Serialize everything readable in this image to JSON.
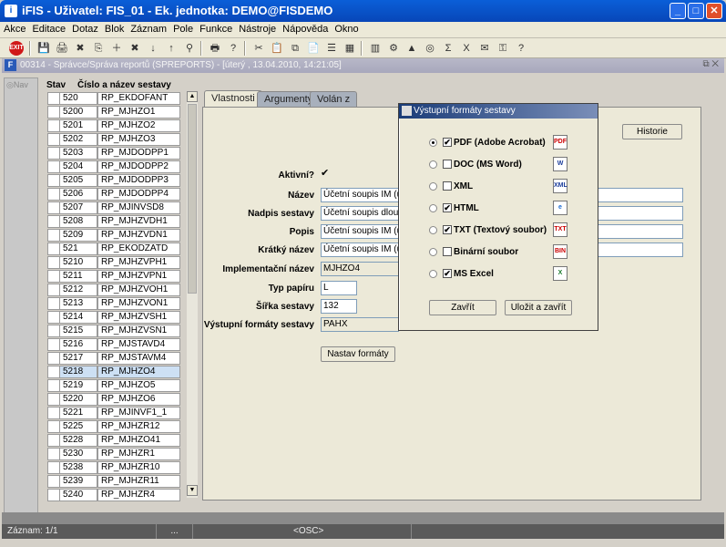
{
  "window": {
    "title": "iFIS - Uživatel: FIS_01 - Ek. jednotka: DEMO@FISDEMO",
    "minimize": "_",
    "maximize": "□",
    "close": "✕"
  },
  "menu": [
    "Akce",
    "Editace",
    "Dotaz",
    "Blok",
    "Záznam",
    "Pole",
    "Funkce",
    "Nástroje",
    "Nápověda",
    "Okno"
  ],
  "toolbar": {
    "exit_label": "EXIT",
    "icons": [
      "save-icon",
      "print-icon",
      "delete-icon",
      "copy-icon",
      "insert-icon",
      "delete-record-icon",
      "sort-asc-icon",
      "sort-desc-icon",
      "filter-icon",
      "printer-icon",
      "query-icon",
      "cut-icon",
      "paste-icon",
      "copy-doc-icon",
      "clipboard-icon",
      "list-icon",
      "grid-icon",
      "calc-icon",
      "settings-icon",
      "chart-icon",
      "globe-icon",
      "sum-icon",
      "excel-icon",
      "mail-icon",
      "key-icon",
      "help-icon"
    ],
    "glyphs": [
      "💾",
      "🖨",
      "✖",
      "⎘",
      "＋",
      "✖",
      "↓",
      "↑",
      "⚲",
      "🖶",
      "?",
      "✂",
      "📋",
      "⧉",
      "📄",
      "☰",
      "▦",
      "▥",
      "⚙",
      "▲",
      "◎",
      "Σ",
      "X",
      "✉",
      "⚿",
      "?"
    ]
  },
  "inner_window": {
    "title": "00314 - Správce/Správa reportů (SPREPORTS) - [úterý , 13.04.2010, 14:21:05]",
    "restore": "⧉ ✕"
  },
  "nav": {
    "label": "Nav"
  },
  "list": {
    "header_stav": "Stav",
    "header_cislo": "Číslo a název sestavy",
    "rows": [
      {
        "num": "520",
        "name": "RP_EKDOFANT"
      },
      {
        "num": "5200",
        "name": "RP_MJHZO1"
      },
      {
        "num": "5201",
        "name": "RP_MJHZO2"
      },
      {
        "num": "5202",
        "name": "RP_MJHZO3"
      },
      {
        "num": "5203",
        "name": "RP_MJDODPP1"
      },
      {
        "num": "5204",
        "name": "RP_MJDODPP2"
      },
      {
        "num": "5205",
        "name": "RP_MJDODPP3"
      },
      {
        "num": "5206",
        "name": "RP_MJDODPP4"
      },
      {
        "num": "5207",
        "name": "RP_MJINVSD8"
      },
      {
        "num": "5208",
        "name": "RP_MJHZVDH1"
      },
      {
        "num": "5209",
        "name": "RP_MJHZVDN1"
      },
      {
        "num": "521",
        "name": "RP_EKODZATD"
      },
      {
        "num": "5210",
        "name": "RP_MJHZVPH1"
      },
      {
        "num": "5211",
        "name": "RP_MJHZVPN1"
      },
      {
        "num": "5212",
        "name": "RP_MJHZVOH1"
      },
      {
        "num": "5213",
        "name": "RP_MJHZVON1"
      },
      {
        "num": "5214",
        "name": "RP_MJHZVSH1"
      },
      {
        "num": "5215",
        "name": "RP_MJHZVSN1"
      },
      {
        "num": "5216",
        "name": "RP_MJSTAVD4"
      },
      {
        "num": "5217",
        "name": "RP_MJSTAVM4"
      },
      {
        "num": "5218",
        "name": "RP_MJHZO4"
      },
      {
        "num": "5219",
        "name": "RP_MJHZO5"
      },
      {
        "num": "5220",
        "name": "RP_MJHZO6"
      },
      {
        "num": "5221",
        "name": "RP_MJINVF1_1"
      },
      {
        "num": "5225",
        "name": "RP_MJHZR12"
      },
      {
        "num": "5228",
        "name": "RP_MJHZO41"
      },
      {
        "num": "5230",
        "name": "RP_MJHZR1"
      },
      {
        "num": "5238",
        "name": "RP_MJHZR10"
      },
      {
        "num": "5239",
        "name": "RP_MJHZR11"
      },
      {
        "num": "5240",
        "name": "RP_MJHZR4"
      }
    ],
    "selected_index": 20
  },
  "tabs": [
    "Vlastnosti",
    "Argumenty",
    "Volán z"
  ],
  "form": {
    "aktivni_label": "Aktivní?",
    "aktivni_check": "✔",
    "nazev_label": "Název",
    "nazev_value": "Účetní soupis IM (účty",
    "nadpis_label": "Nadpis sestavy",
    "nadpis_value": "Účetní soupis dlouhod",
    "popis_label": "Popis",
    "popis_value": "Účetní soupis IM (účty",
    "kratky_label": "Krátký název",
    "kratky_value": "Účetní soupis IM (účty",
    "impl_label": "Implementační název",
    "impl_value": "MJHZO4",
    "typ_label": "Typ papíru",
    "typ_value": "L",
    "sirka_label": "Šířka sestavy",
    "sirka_value": "132",
    "vystupni_label": "Výstupní formáty sestavy",
    "vystupni_value": "PAHX",
    "nastav_button": "Nastav formáty",
    "historie_button": "Historie"
  },
  "dialog": {
    "title": "Výstupní formáty sestavy",
    "items": [
      {
        "label": "PDF (Adobe Acrobat)",
        "checked": true,
        "radio": true,
        "icon": "PDF"
      },
      {
        "label": "DOC (MS Word)",
        "checked": false,
        "radio": false,
        "icon": "W"
      },
      {
        "label": "XML",
        "checked": false,
        "radio": false,
        "icon": "XML"
      },
      {
        "label": "HTML",
        "checked": true,
        "radio": false,
        "icon": "e"
      },
      {
        "label": "TXT (Textový soubor)",
        "checked": true,
        "radio": false,
        "icon": "TXT"
      },
      {
        "label": "Binární soubor",
        "checked": false,
        "radio": false,
        "icon": "BIN"
      },
      {
        "label": "MS Excel",
        "checked": true,
        "radio": false,
        "icon": "X"
      }
    ],
    "close_button": "Zavřít",
    "save_close_button": "Uložit a zavřít"
  },
  "status": {
    "zaznam": "Záznam: 1/1",
    "dots": "...",
    "osc": "<OSC>"
  }
}
